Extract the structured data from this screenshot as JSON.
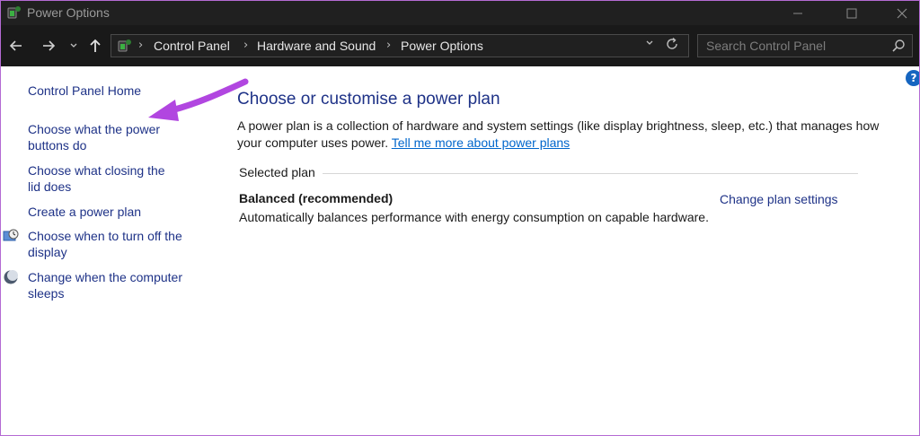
{
  "window": {
    "title": "Power Options"
  },
  "address": {
    "crumbs": [
      "Control Panel",
      "Hardware and Sound",
      "Power Options"
    ]
  },
  "search": {
    "placeholder": "Search Control Panel"
  },
  "sidebar": {
    "items": [
      {
        "label": "Control Panel Home"
      },
      {
        "label": "Choose what the power buttons do"
      },
      {
        "label": "Choose what closing the lid does"
      },
      {
        "label": "Create a power plan"
      },
      {
        "label": "Choose when to turn off the display",
        "icon": "display-icon"
      },
      {
        "label": "Change when the computer sleeps",
        "icon": "moon-icon"
      }
    ]
  },
  "main": {
    "heading": "Choose or customise a power plan",
    "description": "A power plan is a collection of hardware and system settings (like display brightness, sleep, etc.) that manages how your computer uses power.",
    "link": "Tell me more about power plans",
    "selected_label": "Selected plan",
    "plan_name": "Balanced (recommended)",
    "plan_description": "Automatically balances performance with energy consumption on capable hardware.",
    "change_link": "Change plan settings"
  },
  "colors": {
    "titlebar": "#202020",
    "link": "#1e3287",
    "accent": "#b46ad3",
    "help": "#1565c0"
  }
}
